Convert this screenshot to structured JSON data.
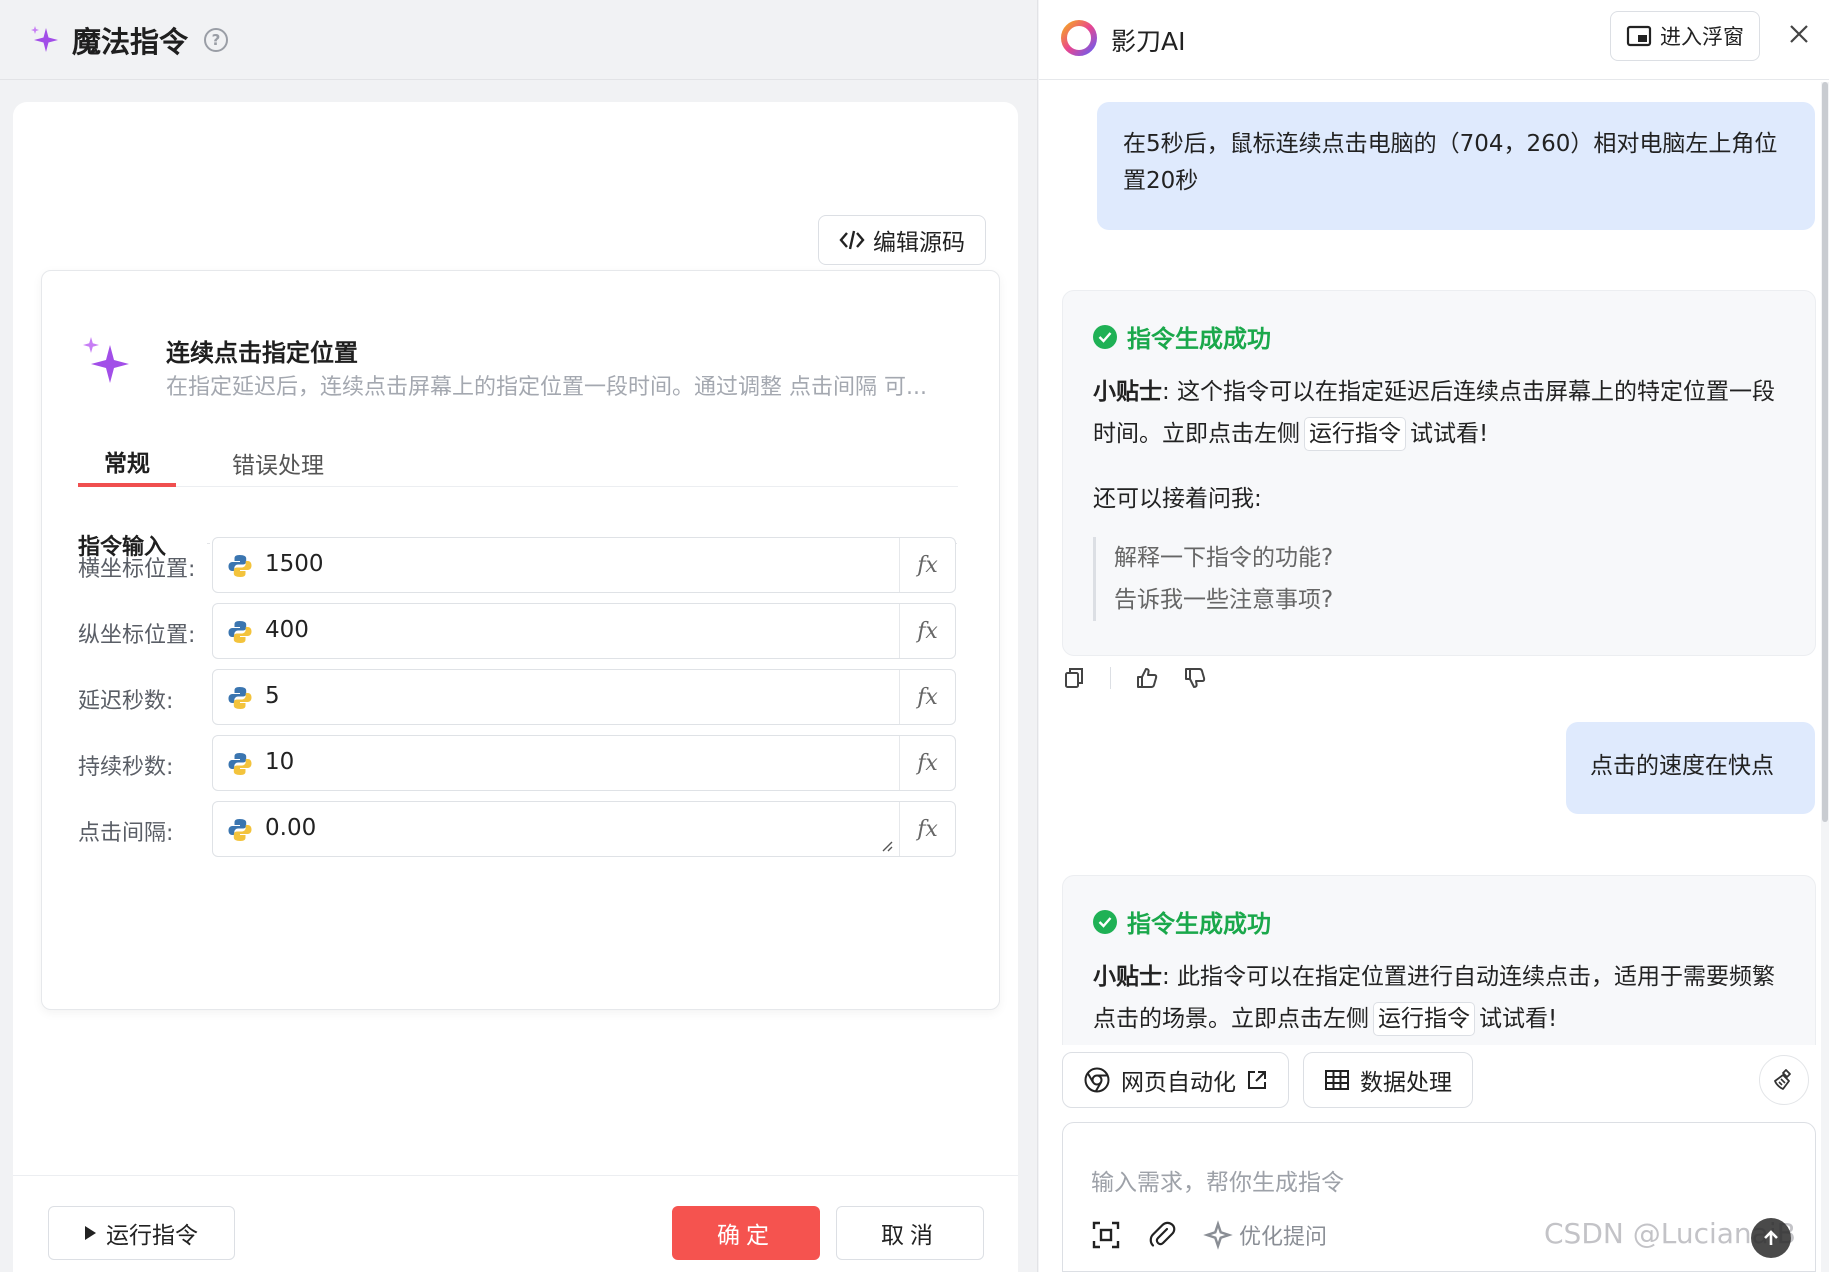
{
  "left": {
    "header": {
      "title": "魔法指令",
      "help_glyph": "?"
    },
    "edit_source_label": "编辑源码",
    "command": {
      "title": "连续点击指定位置",
      "description": "在指定延迟后，连续点击屏幕上的指定位置一段时间。通过调整 点击间隔 可..."
    },
    "tabs": [
      "常规",
      "错误处理"
    ],
    "section_label": "指令输入",
    "fields": [
      {
        "label": "横坐标位置:",
        "value": "1500"
      },
      {
        "label": "纵坐标位置:",
        "value": "400"
      },
      {
        "label": "延迟秒数:",
        "value": "5"
      },
      {
        "label": "持续秒数:",
        "value": "10"
      },
      {
        "label": "点击间隔:",
        "value": "0.00"
      }
    ],
    "fx_label": "fx",
    "footer": {
      "run_label": "运行指令",
      "ok_label": "确定",
      "cancel_label": "取消"
    }
  },
  "right": {
    "header": {
      "name": "影刀AI",
      "float_label": "进入浮窗"
    },
    "messages": {
      "user_1": "在5秒后，鼠标连续点击电脑的（704，260）相对电脑左上角位置20秒",
      "ai_1": {
        "status": "指令生成成功",
        "tip_label": "小贴士",
        "tip_text_a": ": 这个指令可以在指定延迟后连续点击屏幕上的特定位置一段时间。立即点击左侧",
        "tip_chip": "运行指令",
        "tip_text_b": "试试看!",
        "follow_label": "还可以接着问我:",
        "follow_ups": [
          "解释一下指令的功能?",
          "告诉我一些注意事项?"
        ]
      },
      "user_2": "点击的速度在快点",
      "ai_2": {
        "status": "指令生成成功",
        "tip_label": "小贴士",
        "tip_text_a": ": 此指令可以在指定位置进行自动连续点击，适用于需要频繁点击的场景。立即点击左侧",
        "tip_chip": "运行指令",
        "tip_text_b": "试试看!"
      }
    },
    "quick_actions": [
      "网页自动化",
      "数据处理"
    ],
    "input": {
      "placeholder": "输入需求，帮你生成指令",
      "optimize_label": "优化提问"
    },
    "watermark": "CSDN @LucianaiB"
  },
  "colors": {
    "accent_red": "#f5534f",
    "success_green": "#1aa84b",
    "user_bubble": "#dfeafd",
    "sparkle_purple": "#a24ee8"
  },
  "icons": [
    "sparkle-icon",
    "help-icon",
    "code-icon",
    "python-icon",
    "fx-icon",
    "play-icon",
    "ai-logo-icon",
    "float-window-icon",
    "close-icon",
    "check-icon",
    "copy-icon",
    "thumbs-up-icon",
    "thumbs-down-icon",
    "chrome-icon",
    "external-link-icon",
    "table-icon",
    "broom-icon",
    "screenshot-icon",
    "paperclip-icon",
    "magic-icon",
    "send-arrow-icon"
  ]
}
